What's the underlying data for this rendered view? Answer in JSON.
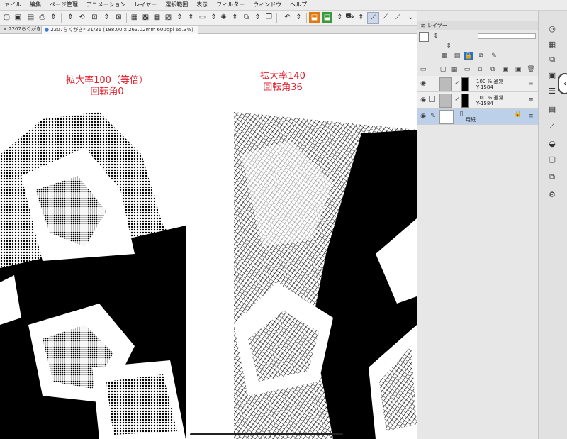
{
  "menu": {
    "items": [
      "ァイル",
      "編集",
      "ページ管理",
      "アニメーション",
      "レイヤー",
      "選択範囲",
      "表示",
      "フィルター",
      "ウィンドウ",
      "ヘルプ"
    ]
  },
  "tabs": [
    {
      "label": "2207らくがき",
      "close": "×"
    },
    {
      "label": "2207らくがき* 31/31 (188.00 x 263.02mm 600dpi 65.3%)",
      "dot": "●"
    }
  ],
  "canvas": {
    "left_caption": {
      "line1": "拡大率100（等倍）",
      "line2": "回転角0"
    },
    "right_caption": {
      "line1": "拡大率140",
      "line2": "回転角36"
    }
  },
  "layer_panel": {
    "title": "レイヤー",
    "layers": [
      {
        "opacity_mode": "100 % 通常",
        "name": "Y-1584",
        "visible": true
      },
      {
        "opacity_mode": "100 % 通常",
        "name": "Y-1584",
        "visible": false
      },
      {
        "name": "用紙",
        "visible": true,
        "selected": true
      }
    ]
  },
  "colors": {
    "caption": "#e0202c",
    "selected_layer": "#bcd0ea",
    "accent": "#e07a10"
  }
}
